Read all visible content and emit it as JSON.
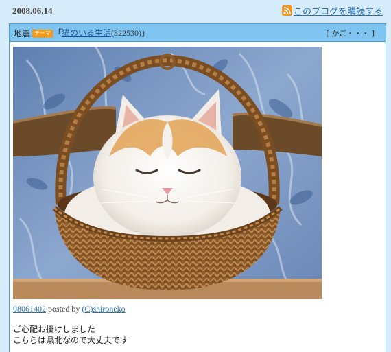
{
  "entry_date": "2008.06.14",
  "subscribe": {
    "label": "このブログを購読する",
    "icon": "rss-feed-icon",
    "icon_color": "#f7941d"
  },
  "post": {
    "category": "地震",
    "theme_badge": "テーマ",
    "title_open": "「",
    "title_link": "猫のいる生活",
    "title_count": "(322530)",
    "title_close": "」",
    "author_tag": "[ かご・・・ ]",
    "image_alt": "white and orange cat sleeping in a wicker basket",
    "meta": {
      "photo_id": "08061402",
      "posted_by": "posted by",
      "author": "(C)shironeko"
    },
    "body_lines": [
      "ご心配お掛けしました",
      "こちらは県北なので大丈夫です"
    ]
  },
  "colors": {
    "page_background": "#d7ecfb",
    "header_background": "#7fc4f0",
    "border": "#4aa3e0",
    "link": "#2a6fb0",
    "badge": "#f39a1a"
  }
}
